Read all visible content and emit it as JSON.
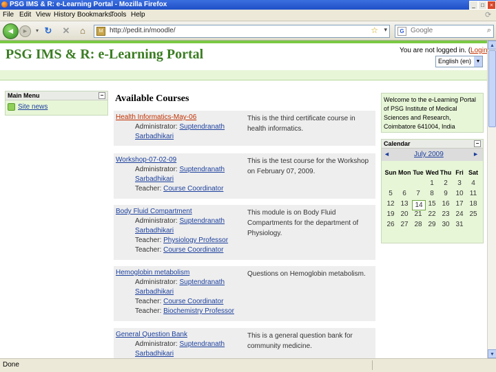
{
  "window": {
    "title": "PSG IMS & R: e-Learning Portal - Mozilla Firefox"
  },
  "menubar": [
    "File",
    "Edit",
    "View",
    "History",
    "Bookmarks",
    "Tools",
    "Help"
  ],
  "toolbar": {
    "url": "http://pedit.in/moodle/",
    "search_placeholder": "Google",
    "back_icon": "back-arrow-icon",
    "forward_icon": "forward-arrow-icon",
    "reload_icon": "reload-icon",
    "stop_icon": "stop-icon",
    "home_icon": "home-icon"
  },
  "header": {
    "site_title": "PSG IMS & R: e-Learning Portal",
    "login_text": "You are not logged in. (",
    "login_link": "Login",
    "login_close": ")",
    "language": "English (en)"
  },
  "main_menu": {
    "title": "Main Menu",
    "collapse": "−",
    "items": [
      {
        "label": "Site news",
        "icon": "news-icon"
      }
    ]
  },
  "courses": {
    "heading": "Available Courses",
    "list": [
      {
        "name": "Health Informatics-May-06",
        "highlight": true,
        "roles": [
          {
            "label": "Administrator: ",
            "person": "Suptendranath"
          },
          {
            "label": "",
            "person": "Sarbadhikari"
          }
        ],
        "description": "This is the third certificate course in health informatics."
      },
      {
        "name": "Workshop-07-02-09",
        "highlight": false,
        "roles": [
          {
            "label": "Administrator: ",
            "person": "Suptendranath"
          },
          {
            "label": "",
            "person": "Sarbadhikari"
          },
          {
            "label": "Teacher: ",
            "person": "Course Coordinator"
          }
        ],
        "description": "This is the test course for the Workshop on February 07, 2009."
      },
      {
        "name": "Body Fluid Compartment",
        "highlight": false,
        "roles": [
          {
            "label": "Administrator: ",
            "person": "Suptendranath"
          },
          {
            "label": "",
            "person": "Sarbadhikari"
          },
          {
            "label": "Teacher: ",
            "person": "Physiology Professor"
          },
          {
            "label": "Teacher: ",
            "person": "Course Coordinator"
          }
        ],
        "description": "This module is on Body Fluid Compartments for the department of Physiology."
      },
      {
        "name": "Hemoglobin metabolism",
        "highlight": false,
        "roles": [
          {
            "label": "Administrator: ",
            "person": "Suptendranath"
          },
          {
            "label": "",
            "person": "Sarbadhikari"
          },
          {
            "label": "Teacher: ",
            "person": "Course Coordinator"
          },
          {
            "label": "Teacher: ",
            "person": "Biochemistry Professor"
          }
        ],
        "description": "Questions on Hemoglobin metabolism."
      },
      {
        "name": "General Question Bank",
        "highlight": false,
        "roles": [
          {
            "label": "Administrator: ",
            "person": "Suptendranath"
          },
          {
            "label": "",
            "person": "Sarbadhikari"
          }
        ],
        "description": "This is a general question bank for community medicine."
      }
    ]
  },
  "welcome": {
    "text": "Welcome to the e-Learning Portal of PSG Institute of Medical Sciences and Research, Coimbatore 641004, India"
  },
  "calendar": {
    "title": "Calendar",
    "collapse": "−",
    "month": "July 2009",
    "prev": "◄",
    "next": "►",
    "weekdays": [
      "Sun",
      "Mon",
      "Tue",
      "Wed",
      "Thu",
      "Fri",
      "Sat"
    ],
    "weeks": [
      [
        "",
        "",
        "",
        "1",
        "2",
        "3",
        "4"
      ],
      [
        "5",
        "6",
        "7",
        "8",
        "9",
        "10",
        "11"
      ],
      [
        "12",
        "13",
        "14",
        "15",
        "16",
        "17",
        "18"
      ],
      [
        "19",
        "20",
        "21",
        "22",
        "23",
        "24",
        "25"
      ],
      [
        "26",
        "27",
        "28",
        "29",
        "30",
        "31",
        ""
      ]
    ],
    "today": "14"
  },
  "statusbar": {
    "text": "Done"
  },
  "colors": {
    "brand_green": "#3b7d23",
    "accent_green": "#7ac943",
    "link_blue": "#1b3f9c",
    "link_red": "#c03000"
  }
}
